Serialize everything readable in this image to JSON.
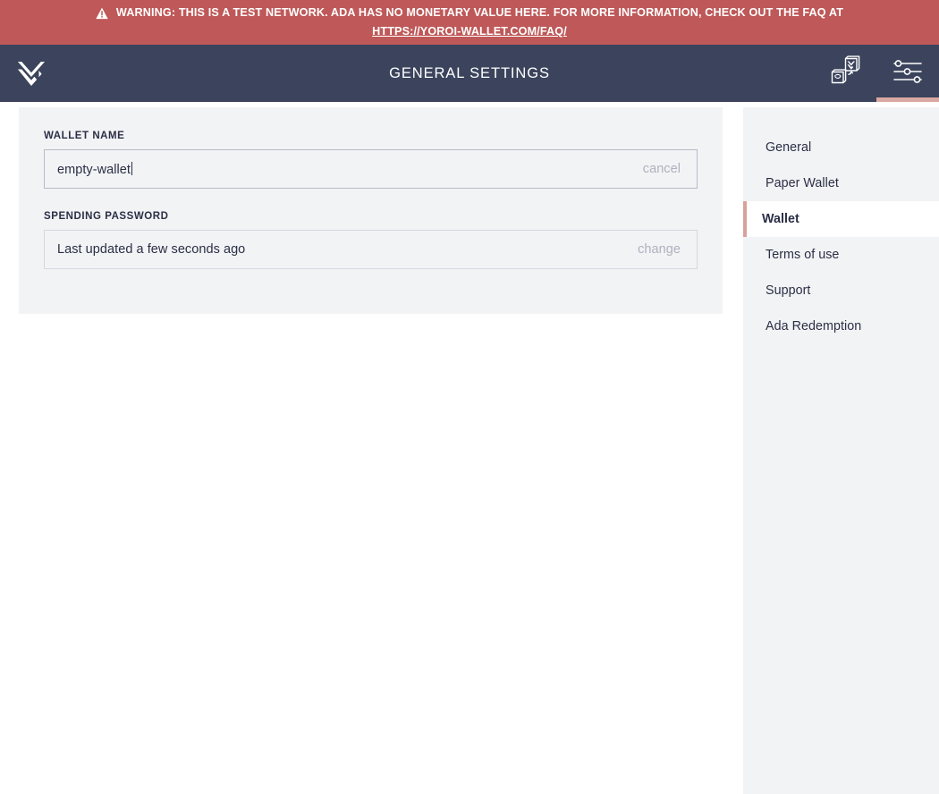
{
  "warning": {
    "icon": "warning-triangle-icon",
    "text": "WARNING: THIS IS A TEST NETWORK. ADA HAS NO MONETARY VALUE HERE. FOR MORE INFORMATION, CHECK OUT THE FAQ AT",
    "link_text": "HTTPS://YOROI-WALLET.COM/FAQ/",
    "bg_color": "#bf5858",
    "text_color": "#ffffff"
  },
  "navbar": {
    "logo_icon": "yoroi-logo-icon",
    "title": "GENERAL SETTINGS",
    "bg_color": "#3b445c",
    "actions": [
      {
        "icon": "wallet-switch-icon",
        "name": "wallet-switch-button",
        "active": false
      },
      {
        "icon": "settings-sliders-icon",
        "name": "settings-button",
        "active": true
      }
    ],
    "active_indicator_color": "#daa8a2"
  },
  "settings": {
    "wallet_name": {
      "label": "WALLET NAME",
      "value": "empty-wallet",
      "placeholder": "Wallet name",
      "action_label": "cancel"
    },
    "spending_password": {
      "label": "SPENDING PASSWORD",
      "value": "Last updated a few seconds ago",
      "action_label": "change"
    }
  },
  "menu": {
    "items": [
      {
        "label": "General",
        "active": false
      },
      {
        "label": "Paper Wallet",
        "active": false
      },
      {
        "label": "Wallet",
        "active": true
      },
      {
        "label": "Terms of use",
        "active": false
      },
      {
        "label": "Support",
        "active": false
      },
      {
        "label": "Ada Redemption",
        "active": false
      }
    ],
    "active_border_color": "#d6a29b",
    "bg_color": "#f2f3f5"
  }
}
